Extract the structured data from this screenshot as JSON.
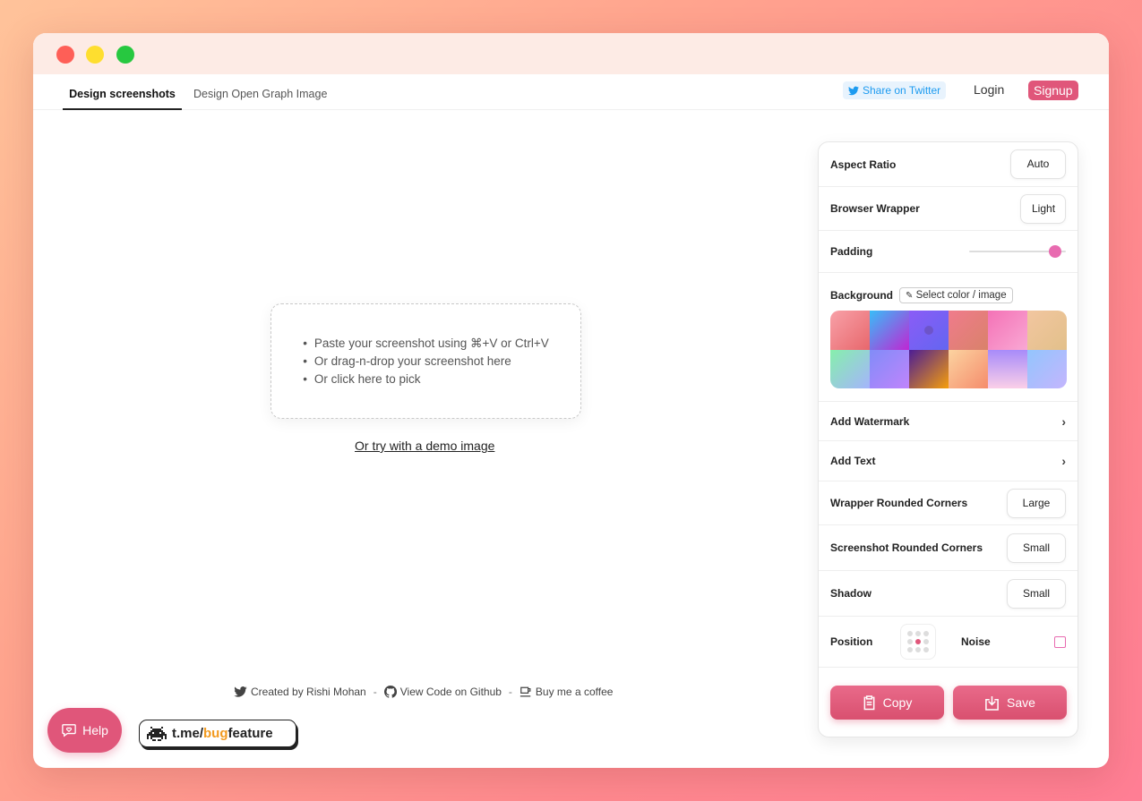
{
  "nav": {
    "tabs": [
      {
        "label": "Design screenshots"
      },
      {
        "label": "Design Open Graph Image"
      }
    ],
    "share_twitter": "Share on Twitter",
    "login": "Login",
    "signup": "Signup"
  },
  "dropzone": {
    "items": [
      "Paste your screenshot using ⌘+V or Ctrl+V",
      "Or drag-n-drop your screenshot here",
      "Or click here to pick"
    ],
    "demo_link": "Or try with a demo image"
  },
  "footer": {
    "created_by": "Created by Rishi Mohan",
    "separator": "-",
    "github": "View Code on Github",
    "coffee": "Buy me a coffee"
  },
  "help": {
    "label": "Help"
  },
  "telegram": {
    "prefix": "t.me/",
    "highlight": "bug",
    "suffix": "feature"
  },
  "panel": {
    "aspect_ratio": {
      "label": "Aspect Ratio",
      "value": "Auto"
    },
    "browser_wrapper": {
      "label": "Browser Wrapper",
      "value": "Light"
    },
    "padding": {
      "label": "Padding",
      "value_fraction": 0.95
    },
    "background": {
      "label": "Background",
      "select_label": "Select color / image",
      "swatches": [
        "linear-gradient(135deg,#f8a1a8,#e8676c)",
        "linear-gradient(135deg,#38bdf8,#c026d3)",
        "linear-gradient(135deg,#8b5cf6,#6366f1)",
        "linear-gradient(135deg,#f07b8c,#d9826a)",
        "linear-gradient(135deg,#f472b6,#f9a8d4)",
        "linear-gradient(135deg,#f2c6a0,#e2c08a)",
        "linear-gradient(135deg,#86efac,#a5b4fc)",
        "linear-gradient(135deg,#818cf8,#c084fc)",
        "linear-gradient(135deg,#4c1d95,#f59e0b)",
        "linear-gradient(135deg,#fcd3a0,#f58c6c)",
        "linear-gradient(180deg,#a78bfa,#fbcfe8)",
        "linear-gradient(135deg,#93c5fd,#c4b5fd)"
      ],
      "selected_index": 2
    },
    "watermark": {
      "label": "Add Watermark"
    },
    "add_text": {
      "label": "Add Text"
    },
    "wrapper_corners": {
      "label": "Wrapper Rounded Corners",
      "value": "Large"
    },
    "screenshot_corners": {
      "label": "Screenshot Rounded Corners",
      "value": "Small"
    },
    "shadow": {
      "label": "Shadow",
      "value": "Small"
    },
    "position": {
      "label": "Position",
      "selected_index": 4
    },
    "noise": {
      "label": "Noise",
      "checked": false
    },
    "copy": "Copy",
    "save": "Save"
  },
  "colors": {
    "accent": "#e0567a",
    "slider": "#e86bb0"
  }
}
